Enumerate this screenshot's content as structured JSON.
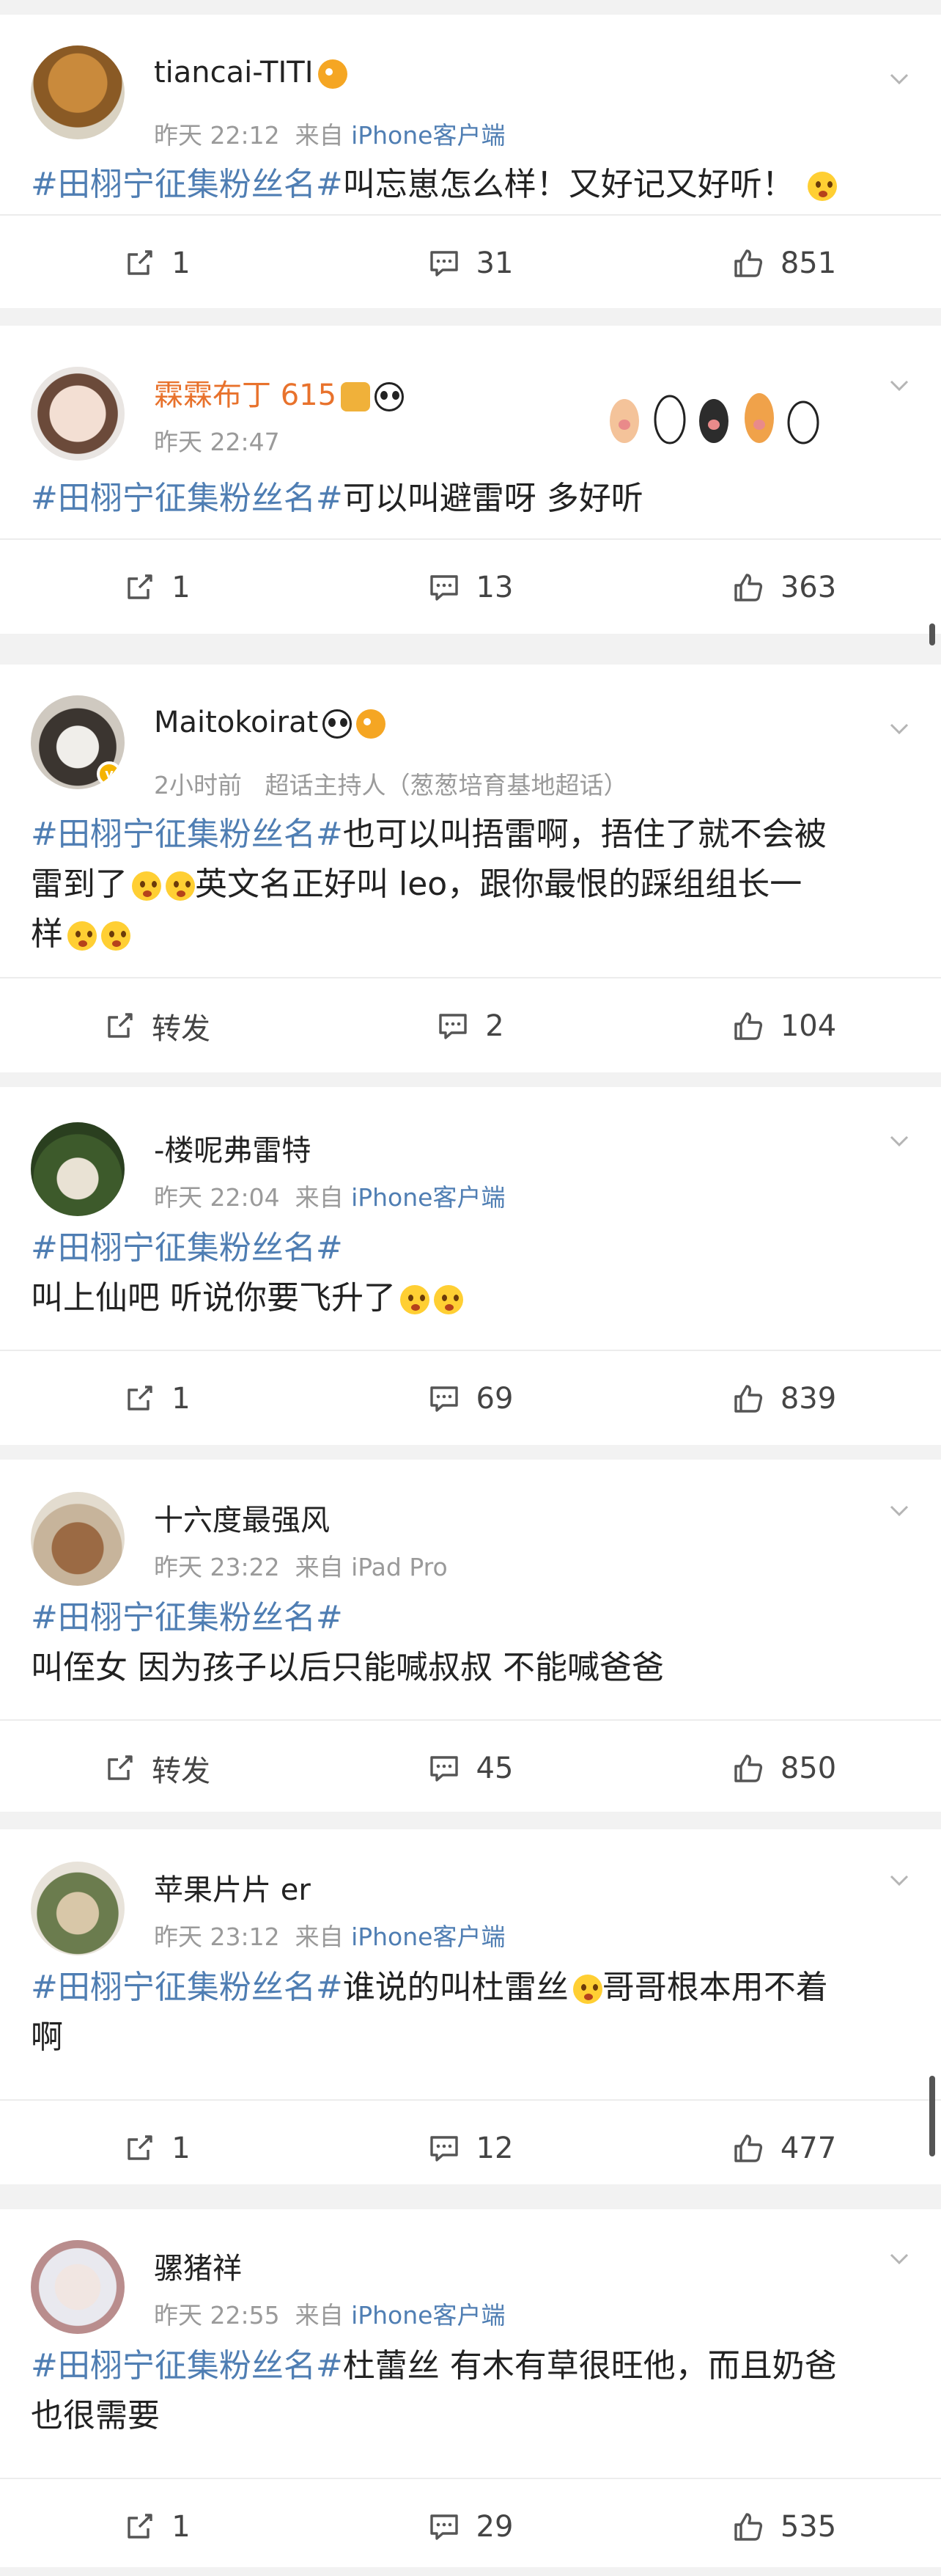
{
  "posts": [
    {
      "username": "tiancai-TITI",
      "time": "昨天 22:12",
      "from": "来自",
      "source": "iPhone客户端",
      "hashtag": "#田栩宁征集粉丝名#",
      "text": "叫忘崽怎么样！又好记又好听！",
      "repost": "1",
      "comments": "31",
      "likes": "851"
    },
    {
      "username": "霖霖布丁 615",
      "time": "昨天 22:47",
      "from": "",
      "source": "",
      "hashtag": "#田栩宁征集粉丝名#",
      "text": "可以叫避雷呀  多好听",
      "repost": "1",
      "comments": "13",
      "likes": "363"
    },
    {
      "username": "Maitokoirat",
      "time": "2小时前",
      "from": "超话主持人（葱葱培育基地超话）",
      "source": "",
      "hashtag": "#田栩宁征集粉丝名#",
      "text_line1": "也可以叫捂雷啊，捂住了就不会被",
      "text_line2a": "雷到了",
      "text_line2b": "英文名正好叫 leo，跟你最恨的踩组组长一",
      "text_line3": "样",
      "repost": "转发",
      "comments": "2",
      "likes": "104"
    },
    {
      "username": "-楼呢弗雷特",
      "time": "昨天 22:04",
      "from": "来自",
      "source": "iPhone客户端",
      "hashtag": "#田栩宁征集粉丝名#",
      "text": "叫上仙吧  听说你要飞升了",
      "repost": "1",
      "comments": "69",
      "likes": "839"
    },
    {
      "username": "十六度最强风",
      "time": "昨天 23:22",
      "from": "来自 iPad Pro",
      "source": "",
      "hashtag": "#田栩宁征集粉丝名#",
      "text": "叫侄女 因为孩子以后只能喊叔叔 不能喊爸爸",
      "repost": "转发",
      "comments": "45",
      "likes": "850"
    },
    {
      "username": "苹果片片 er",
      "time": "昨天 23:12",
      "from": "来自",
      "source": "iPhone客户端",
      "hashtag": "#田栩宁征集粉丝名#",
      "text_line1": "谁说的叫杜雷丝",
      "text_line1b": "哥哥根本用不着",
      "text_line2": "啊",
      "repost": "1",
      "comments": "12",
      "likes": "477"
    },
    {
      "username": "骡猪祥",
      "time": "昨天 22:55",
      "from": "来自",
      "source": "iPhone客户端",
      "hashtag": "#田栩宁征集粉丝名#",
      "text_line1": "杜蕾丝 有木有草很旺他，而且奶爸",
      "text_line2": "也很需要",
      "repost": "1",
      "comments": "29",
      "likes": "535"
    }
  ],
  "colors": {
    "link": "#4f7eb3",
    "orange_name": "#e8722c",
    "meta": "#9a9a9a"
  },
  "icons": [
    "repost-icon",
    "comment-icon",
    "like-icon",
    "chevron-down-icon"
  ]
}
